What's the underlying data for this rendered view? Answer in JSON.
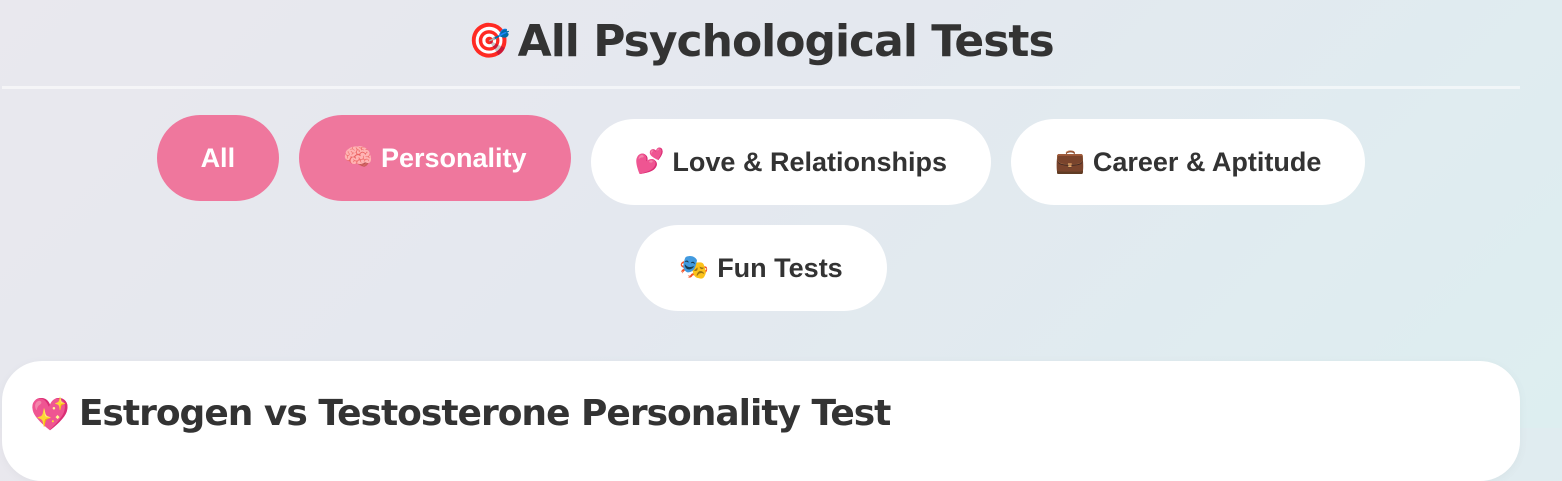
{
  "header": {
    "title_icon": "🎯",
    "title_icon_name": "target-icon",
    "title": "All Psychological Tests"
  },
  "filters": [
    {
      "label": "All",
      "icon": "",
      "active": true
    },
    {
      "label": "Personality",
      "icon": "🧠",
      "icon_name": "brain-icon",
      "active": true
    },
    {
      "label": "Love & Relationships",
      "icon": "💕",
      "icon_name": "two-hearts-icon",
      "active": false
    },
    {
      "label": "Career & Aptitude",
      "icon": "💼",
      "icon_name": "briefcase-icon",
      "active": false
    },
    {
      "label": "Fun Tests",
      "icon": "🎭",
      "icon_name": "theater-masks-icon",
      "active": false
    }
  ],
  "cards": [
    {
      "icon": "💖",
      "icon_name": "sparkling-heart-icon",
      "title": "Estrogen vs Testosterone Personality Test"
    }
  ],
  "colors": {
    "accent": "#ef779d",
    "text": "#333333",
    "pill_inactive_bg": "#ffffff"
  }
}
